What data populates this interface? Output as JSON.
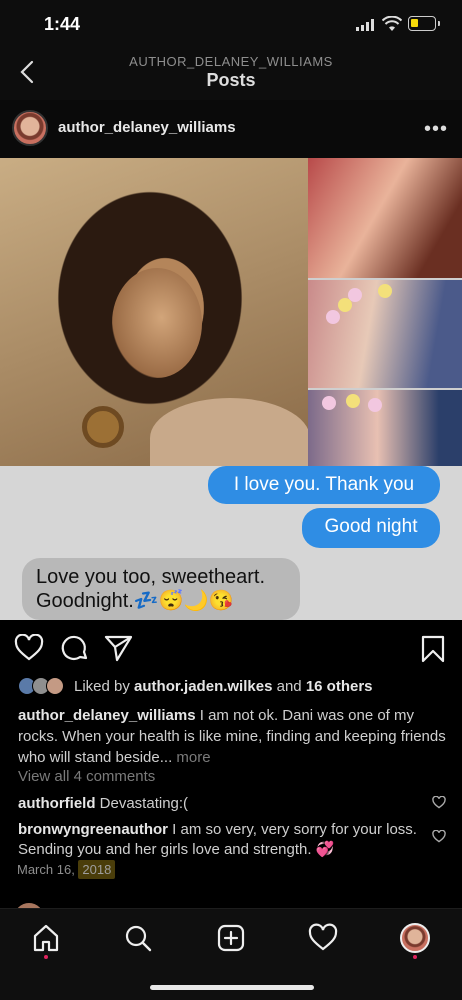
{
  "status_bar": {
    "time": "1:44"
  },
  "header": {
    "username": "AUTHOR_DELANEY_WILLIAMS",
    "title": "Posts"
  },
  "post": {
    "author": "author_delaney_williams",
    "messages": {
      "sent_1": "I love you. Thank you",
      "sent_2": "Good night",
      "received": "Love you too, sweetheart. Goodnight.💤😴🌙😘"
    },
    "likes": {
      "prefix": "Liked by ",
      "user": "author.jaden.wilkes",
      "middle": " and ",
      "others": "16 others"
    },
    "caption": {
      "username": "author_delaney_williams",
      "text": " I am not ok. Dani was one of my rocks. When your health is like mine, finding and keeping friends who will stand beside...",
      "more": " more"
    },
    "view_comments": "View all 4 comments",
    "comments": [
      {
        "user": "authorfield",
        "text": " Devastating:("
      },
      {
        "user": "bronwyngreenauthor",
        "text": " I am so very, very sorry for your loss. Sending you and her girls love and strength. 💞"
      }
    ],
    "date": "March 16, ",
    "year": "2018"
  },
  "icons": {
    "back": "chevron-left-icon",
    "more": "ellipsis-icon",
    "like": "heart-icon",
    "comment": "comment-icon",
    "share": "paper-plane-icon",
    "save": "bookmark-icon",
    "home": "home-icon",
    "search": "search-icon",
    "new_post": "add-post-icon",
    "activity": "heart-icon",
    "profile": "profile-avatar"
  },
  "colors": {
    "accent_blue": "#2f8de4",
    "notification_dot": "#e0245e",
    "background": "#000000"
  }
}
